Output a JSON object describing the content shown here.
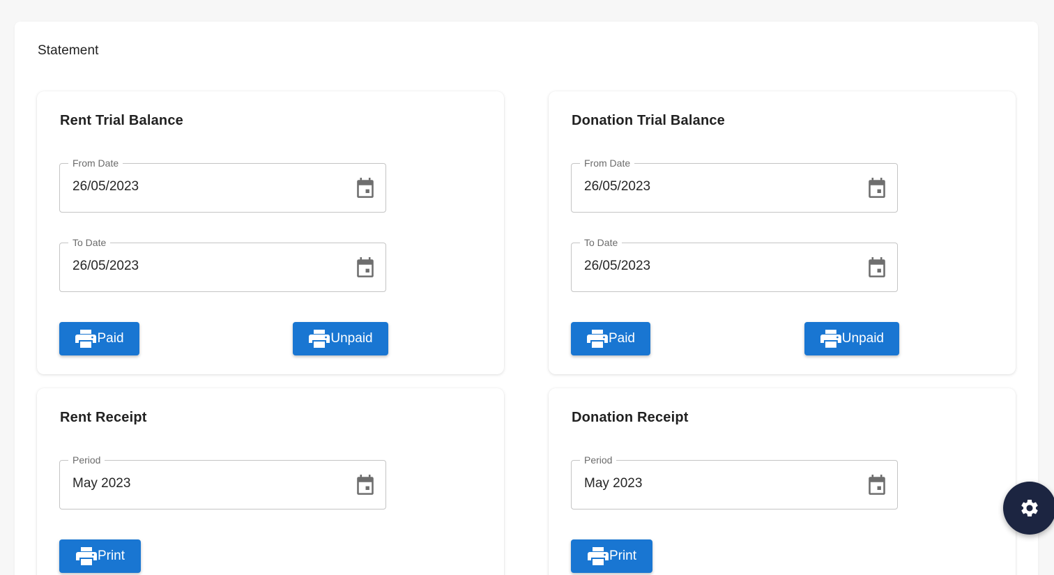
{
  "page": {
    "title": "Statement"
  },
  "rent_trial_balance": {
    "title": "Rent Trial Balance",
    "from_date": {
      "label": "From Date",
      "value": "26/05/2023"
    },
    "to_date": {
      "label": "To Date",
      "value": "26/05/2023"
    },
    "paid_label": "Paid",
    "unpaid_label": "Unpaid"
  },
  "donation_trial_balance": {
    "title": "Donation Trial Balance",
    "from_date": {
      "label": "From Date",
      "value": "26/05/2023"
    },
    "to_date": {
      "label": "To Date",
      "value": "26/05/2023"
    },
    "paid_label": "Paid",
    "unpaid_label": "Unpaid"
  },
  "rent_receipt": {
    "title": "Rent Receipt",
    "period": {
      "label": "Period",
      "value": "May 2023"
    },
    "print_label": "Print"
  },
  "donation_receipt": {
    "title": "Donation Receipt",
    "period": {
      "label": "Period",
      "value": "May 2023"
    },
    "print_label": "Print"
  },
  "icons": {
    "calendar": "calendar-icon",
    "printer": "printer-icon",
    "settings": "gear-icon"
  },
  "colors": {
    "primary": "#1976d2",
    "fab": "#1c2541",
    "background": "#f7f7f7"
  }
}
